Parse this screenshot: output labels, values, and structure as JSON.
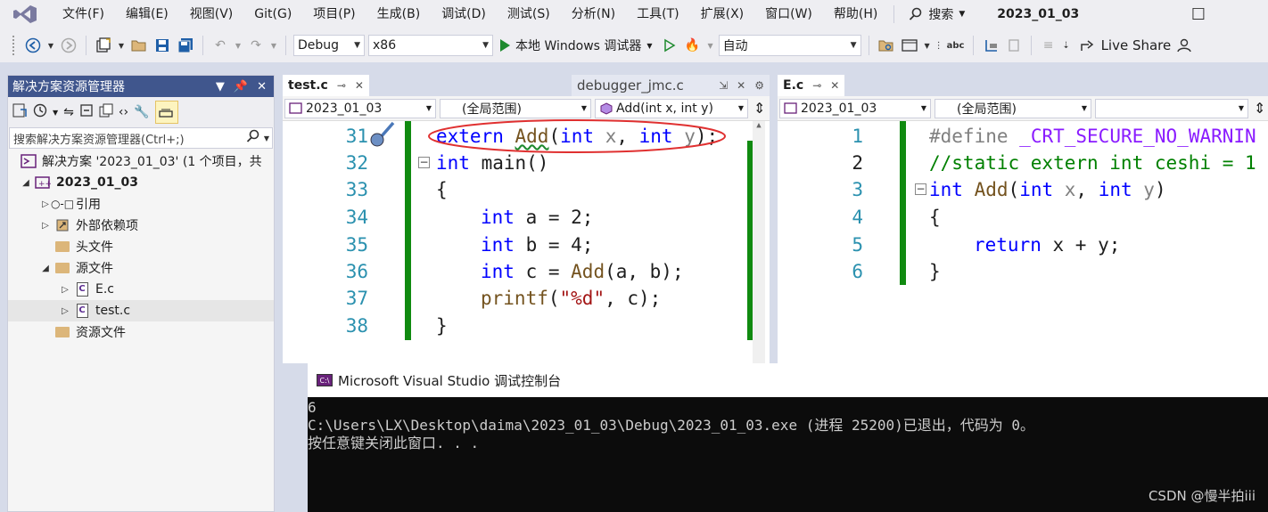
{
  "menubar": {
    "items": [
      "文件(F)",
      "编辑(E)",
      "视图(V)",
      "Git(G)",
      "项目(P)",
      "生成(B)",
      "调试(D)",
      "测试(S)",
      "分析(N)",
      "工具(T)",
      "扩展(X)",
      "窗口(W)",
      "帮助(H)"
    ],
    "search_label": "搜索",
    "solution_name": "2023_01_03"
  },
  "toolbar": {
    "config": "Debug",
    "platform": "x86",
    "run_label": "本地 Windows 调试器",
    "run_mode": "自动",
    "live_share": "Live Share"
  },
  "solution_explorer": {
    "title": "解决方案资源管理器",
    "search_placeholder": "搜索解决方案资源管理器(Ctrl+;)",
    "tree": [
      {
        "label": "解决方案 '2023_01_03' (1 个项目，共",
        "icon": "solution-icon"
      },
      {
        "label": "2023_01_03",
        "icon": "project-icon"
      },
      {
        "label": "引用",
        "icon": "references-icon"
      },
      {
        "label": "外部依赖项",
        "icon": "external-deps-icon"
      },
      {
        "label": "头文件",
        "icon": "folder-icon"
      },
      {
        "label": "源文件",
        "icon": "folder-icon"
      },
      {
        "label": "E.c",
        "icon": "c-file-icon"
      },
      {
        "label": "test.c",
        "icon": "c-file-icon"
      },
      {
        "label": "资源文件",
        "icon": "folder-icon"
      }
    ]
  },
  "editor_left": {
    "tabs": {
      "active": "test.c",
      "preview": "debugger_jmc.c"
    },
    "nav": {
      "project": "2023_01_03",
      "scope": "(全局范围)",
      "member": "Add(int x, int y)"
    },
    "line_numbers": [
      "31",
      "32",
      "33",
      "34",
      "35",
      "36",
      "37",
      "38"
    ]
  },
  "editor_right": {
    "tabs": {
      "active": "E.c"
    },
    "nav": {
      "project": "2023_01_03",
      "scope": "(全局范围)"
    },
    "line_numbers": [
      "1",
      "2",
      "3",
      "4",
      "5",
      "6"
    ]
  },
  "console": {
    "title": "Microsoft Visual Studio 调试控制台",
    "lines": [
      "6",
      "C:\\Users\\LX\\Desktop\\daima\\2023_01_03\\Debug\\2023_01_03.exe (进程 25200)已退出，代码为 0。",
      "按任意键关闭此窗口. . ."
    ]
  },
  "watermark": "CSDN @慢半拍iii"
}
